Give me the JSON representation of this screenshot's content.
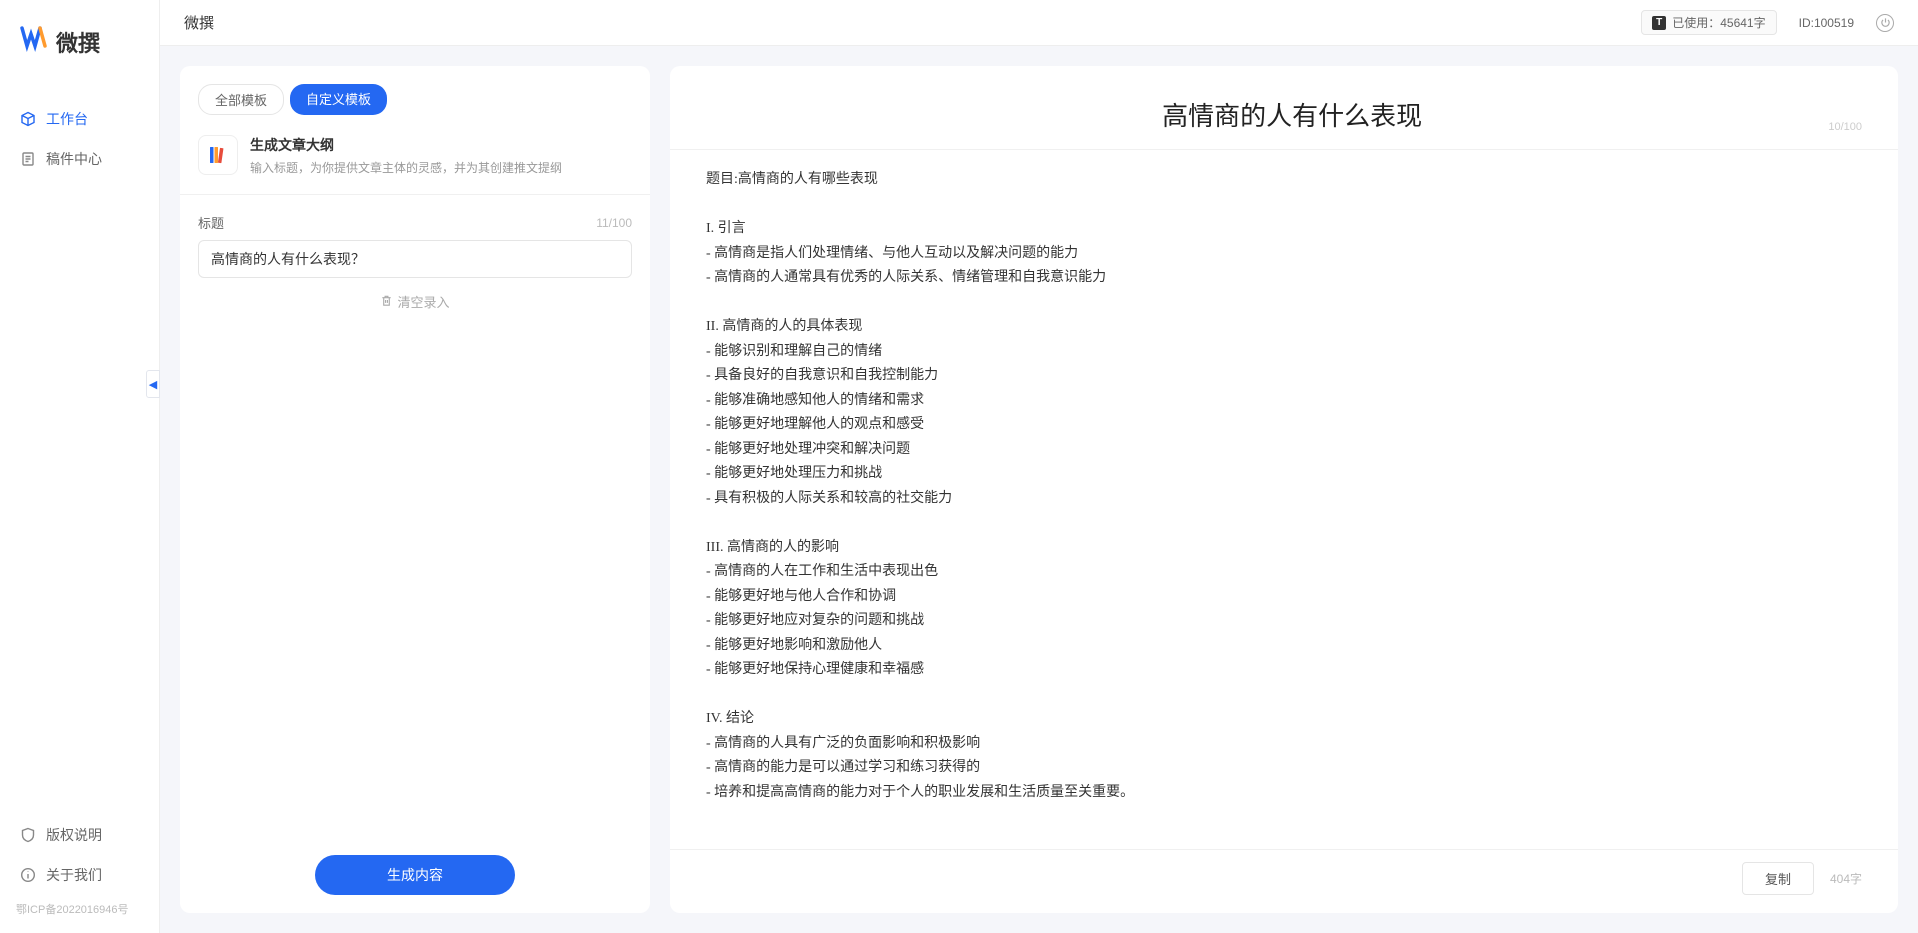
{
  "app": {
    "brand": "微撰",
    "header_title": "微撰"
  },
  "sidebar": {
    "nav": [
      {
        "label": "工作台",
        "active": true
      },
      {
        "label": "稿件中心",
        "active": false
      }
    ],
    "footer_links": [
      {
        "label": "版权说明"
      },
      {
        "label": "关于我们"
      }
    ],
    "icp": "鄂ICP备2022016946号"
  },
  "topbar": {
    "usage_label": "已使用：45641字",
    "id_label": "ID:100519"
  },
  "tabs": {
    "all_label": "全部模板",
    "custom_label": "自定义模板"
  },
  "template": {
    "title": "生成文章大纲",
    "desc": "输入标题，为你提供文章主体的灵感，并为其创建推文提纲"
  },
  "form": {
    "label": "标题",
    "char_count": "11/100",
    "value": "高情商的人有什么表现？",
    "clear_label": "清空录入",
    "generate_label": "生成内容"
  },
  "output": {
    "title": "高情商的人有什么表现",
    "header_count": "10/100",
    "body": "题目:高情商的人有哪些表现\n\nI. 引言\n- 高情商是指人们处理情绪、与他人互动以及解决问题的能力\n- 高情商的人通常具有优秀的人际关系、情绪管理和自我意识能力\n\nII. 高情商的人的具体表现\n- 能够识别和理解自己的情绪\n- 具备良好的自我意识和自我控制能力\n- 能够准确地感知他人的情绪和需求\n- 能够更好地理解他人的观点和感受\n- 能够更好地处理冲突和解决问题\n- 能够更好地处理压力和挑战\n- 具有积极的人际关系和较高的社交能力\n\nIII. 高情商的人的影响\n- 高情商的人在工作和生活中表现出色\n- 能够更好地与他人合作和协调\n- 能够更好地应对复杂的问题和挑战\n- 能够更好地影响和激励他人\n- 能够更好地保持心理健康和幸福感\n\nIV. 结论\n- 高情商的人具有广泛的负面影响和积极影响\n- 高情商的能力是可以通过学习和练习获得的\n- 培养和提高高情商的能力对于个人的职业发展和生活质量至关重要。",
    "copy_label": "复制",
    "word_stat": "404字"
  }
}
